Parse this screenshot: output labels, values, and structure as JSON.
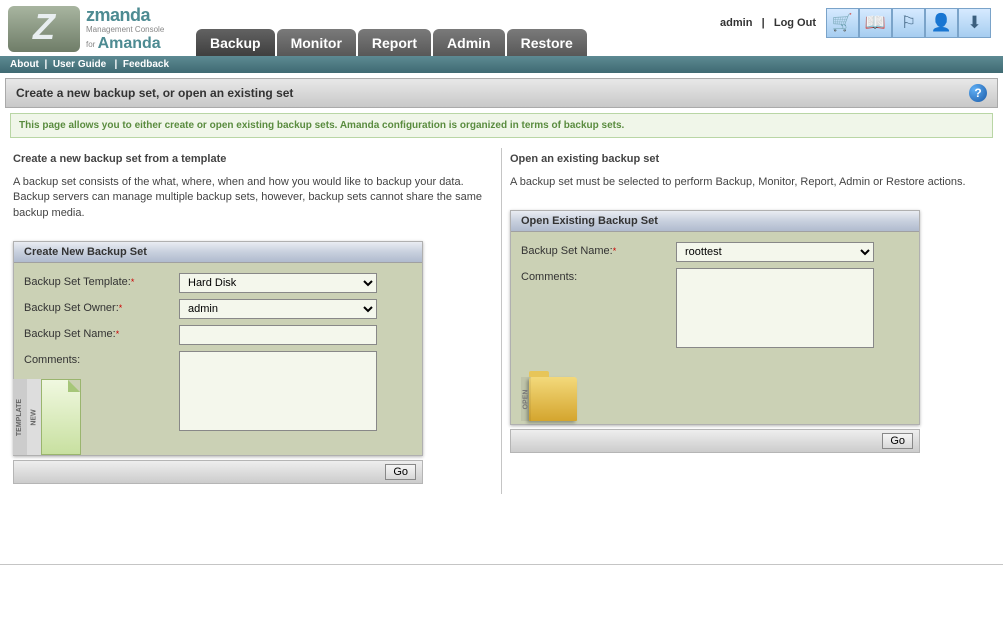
{
  "header": {
    "brand": "zmanda",
    "sub1": "Management Console",
    "sub2": "Amanda",
    "user": "admin",
    "logout": "Log Out",
    "tabs": [
      "Backup",
      "Monitor",
      "Report",
      "Admin",
      "Restore"
    ]
  },
  "sublinks": {
    "about": "About",
    "guide": "User Guide",
    "feedback": "Feedback"
  },
  "page": {
    "title": "Create a new backup set, or open an existing set",
    "info": "This page allows you to either create or open existing backup sets. Amanda configuration is organized in terms of backup sets."
  },
  "left": {
    "heading": "Create a new backup set from a template",
    "desc": "A backup set consists of the what, where, when and how you would like to backup your data. Backup servers can manage multiple backup sets, however, backup sets cannot share the same backup media.",
    "panel_title": "Create New Backup Set",
    "lbl_template": "Backup Set Template:",
    "lbl_owner": "Backup Set Owner:",
    "lbl_name": "Backup Set Name:",
    "lbl_comments": "Comments:",
    "template_value": "Hard Disk",
    "owner_value": "admin",
    "name_value": "",
    "comments_value": "",
    "badge_strip1": "TEMPLATE",
    "badge_strip2": "NEW",
    "go": "Go"
  },
  "right": {
    "heading": "Open an existing backup set",
    "desc": "A backup set must be selected to perform Backup, Monitor, Report, Admin or Restore actions.",
    "panel_title": "Open Existing Backup Set",
    "lbl_name": "Backup Set Name:",
    "lbl_comments": "Comments:",
    "name_value": "roottest",
    "comments_value": "",
    "badge_strip": "OPEN",
    "go": "Go"
  }
}
